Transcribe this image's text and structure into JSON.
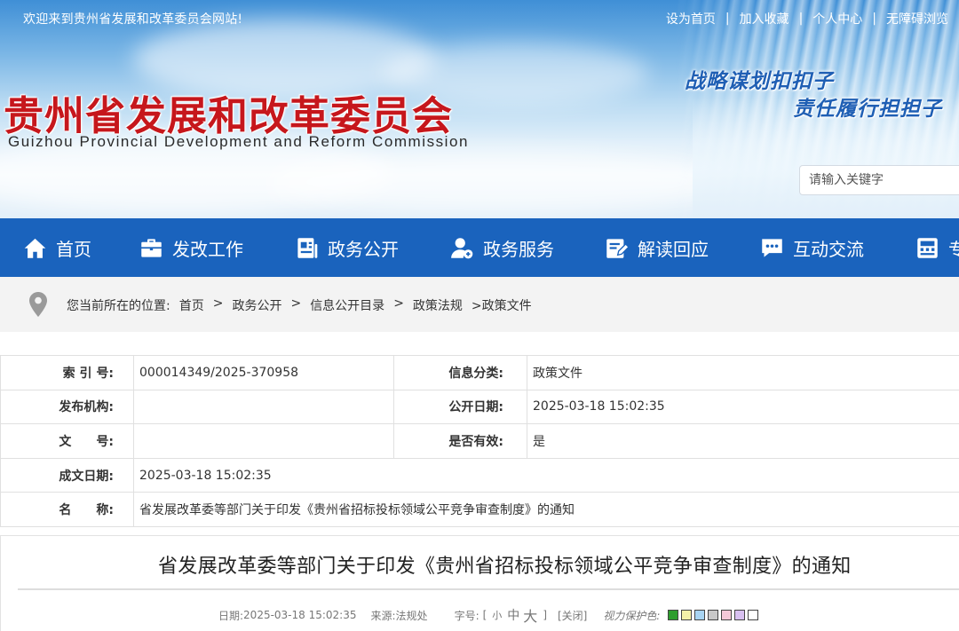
{
  "topbar": {
    "welcome": "欢迎来到贵州省发展和改革委员会网站!",
    "links": [
      "设为首页",
      "加入收藏",
      "个人中心",
      "无障碍浏览"
    ],
    "separator": "|"
  },
  "header": {
    "title_cn": "贵州省发展和改革委员会",
    "title_en": "Guizhou Provincial Development and Reform Commission",
    "slogan_line1": "战略谋划扣扣子",
    "slogan_line2": "责任履行担担子"
  },
  "search": {
    "placeholder": "请输入关键字"
  },
  "nav": {
    "items": [
      {
        "label": "首页",
        "icon": "home-icon"
      },
      {
        "label": "发改工作",
        "icon": "briefcase-icon"
      },
      {
        "label": "政务公开",
        "icon": "document-icon"
      },
      {
        "label": "政务服务",
        "icon": "user-service-icon"
      },
      {
        "label": "解读回应",
        "icon": "edit-icon"
      },
      {
        "label": "互动交流",
        "icon": "chat-icon"
      },
      {
        "label": "专",
        "icon": "topic-icon"
      }
    ]
  },
  "breadcrumb": {
    "prefix": "您当前所在的位置:",
    "items": [
      "首页",
      "政务公开",
      "信息公开目录",
      "政策法规",
      ">政策文件"
    ],
    "separator": ">"
  },
  "info": {
    "index_label": "索 引 号:",
    "index_value": "000014349/2025-370958",
    "category_label": "信息分类:",
    "category_value": "政策文件",
    "publisher_label": "发布机构:",
    "publisher_value": "",
    "public_date_label": "公开日期:",
    "public_date_value": "2025-03-18 15:02:35",
    "doc_no_label": "文　　号:",
    "doc_no_value": "",
    "valid_label": "是否有效:",
    "valid_value": "是",
    "written_date_label": "成文日期:",
    "written_date_value": "2025-03-18 15:02:35",
    "name_label": "名　　称:",
    "name_value": "省发展改革委等部门关于印发《贵州省招标投标领域公平竞争审查制度》的通知"
  },
  "article": {
    "title": "省发展改革委等部门关于印发《贵州省招标投标领域公平竞争审查制度》的通知",
    "meta": {
      "date_label": "日期:",
      "date_value": "2025-03-18 15:02:35",
      "source_label": "来源:",
      "source_value": "法规处",
      "font_label": "字号:",
      "bracket_open": "[",
      "size_small": "小",
      "size_medium": "中",
      "size_large": "大",
      "bracket_close": "]",
      "close_label": "[关闭]",
      "eye_label": "视力保护色:"
    },
    "eye_colors": [
      "#2e9e2e",
      "#f4f0a8",
      "#a8d4f2",
      "#c8c8c8",
      "#f4c8d8",
      "#d8c0f0",
      "#ffffff"
    ]
  },
  "colors": {
    "nav_bg": "#1a63bd",
    "title_red": "#c6171c",
    "slogan_blue": "#1f5fb4"
  }
}
